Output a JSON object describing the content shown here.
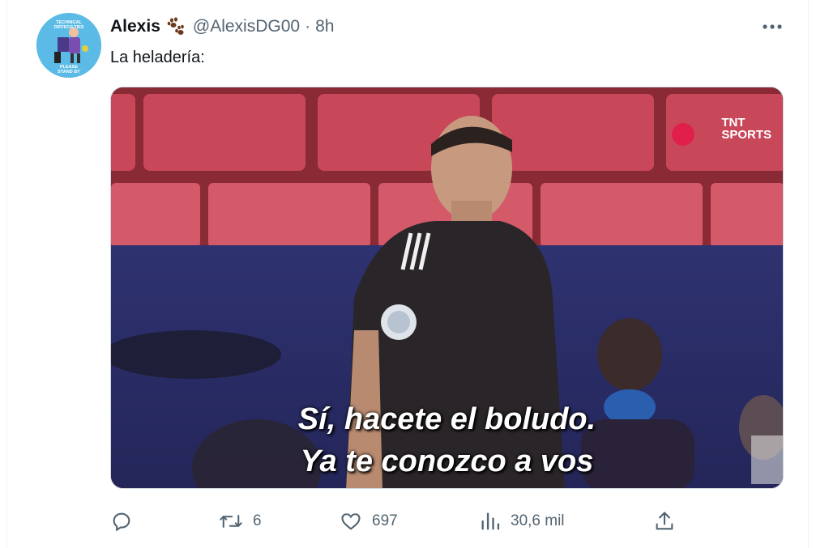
{
  "tweet": {
    "author_name": "Alexis",
    "handle": "@AlexisDG00",
    "separator": "·",
    "time": "8h",
    "text": "La heladería:",
    "avatar_text": [
      "TECHNICAL",
      "DIFFICULTIES",
      "PLEASE",
      "STAND BY"
    ],
    "media": {
      "caption_line1": "Sí, hacete el boludo.",
      "caption_line2": "Ya te conozco a vos",
      "logo_line1": "TNT",
      "logo_line2": "SPORTS"
    },
    "stats": {
      "replies": "",
      "retweets": "6",
      "likes": "697",
      "views": "30,6 mil"
    }
  },
  "icons": {
    "paw": "paw-prints-emoji",
    "more": "more-horizontal-icon",
    "reply": "reply-icon",
    "retweet": "retweet-icon",
    "like": "heart-icon",
    "views": "bar-chart-icon",
    "share": "share-icon"
  },
  "colors": {
    "text_primary": "#0f1419",
    "text_secondary": "#536471",
    "avatar_bg": "#5bbbe6",
    "seat_red": "#c8485a"
  }
}
